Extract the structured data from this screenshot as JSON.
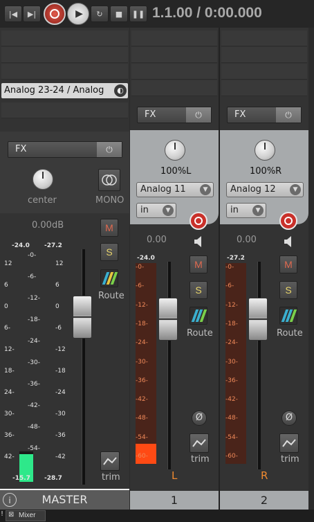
{
  "transport": {
    "timecode": "1.1.00 / 0:00.000",
    "buttons": [
      "skip-back-icon",
      "skip-forward-icon",
      "record-icon",
      "play-icon",
      "repeat-icon",
      "stop-icon",
      "pause-icon"
    ]
  },
  "master": {
    "input_label": "Analog 23-24 / Analog",
    "fx_label": "FX",
    "pan_label": "center",
    "mono_label": "MONO",
    "volume": "0.00dB",
    "peak_left": "-24.0",
    "peak_right": "-27.2",
    "mute_label": "M",
    "solo_label": "S",
    "route_label": "Route",
    "trim_label": "trim",
    "scale_left": [
      "12",
      "6",
      "0",
      "6-",
      "12-",
      "18-",
      "24-",
      "30-",
      "36-",
      "42-"
    ],
    "scale_mid": [
      "-0-",
      "-6-",
      "-12-",
      "-18-",
      "-24-",
      "-30-",
      "-36-",
      "-42-",
      "-48-",
      "-54-"
    ],
    "scale_right": [
      "12",
      "6",
      "0",
      "-6",
      "-12",
      "-18",
      "-24",
      "-30",
      "-36",
      "-42"
    ],
    "meter_bottom_left": "-15.7",
    "meter_bottom_right": "-28.7",
    "name": "MASTER",
    "info_icon": "i"
  },
  "tracks": [
    {
      "fx_label": "FX",
      "pan_label": "100%L",
      "input": "Analog 11",
      "in_label": "in",
      "volume": "0.00",
      "peak": "-24.0",
      "mute_label": "M",
      "solo_label": "S",
      "route_label": "Route",
      "trim_label": "trim",
      "phase_label": "Ø",
      "scale": [
        "-0-",
        "-6-",
        "-12-",
        "-18-",
        "-24-",
        "-30-",
        "-36-",
        "-42-",
        "-48-",
        "-54-",
        "-60-"
      ],
      "channel_label": "L",
      "number": "1",
      "meter_level": 0.1
    },
    {
      "fx_label": "FX",
      "pan_label": "100%R",
      "input": "Analog 12",
      "in_label": "in",
      "volume": "0.00",
      "peak": "-27.2",
      "mute_label": "M",
      "solo_label": "S",
      "route_label": "Route",
      "trim_label": "trim",
      "phase_label": "Ø",
      "scale": [
        "-0-",
        "-6-",
        "-12-",
        "-18-",
        "-24-",
        "-30-",
        "-36-",
        "-42-",
        "-48-",
        "-54-",
        "-60-"
      ],
      "channel_label": "R",
      "number": "2",
      "meter_level": 0.0
    }
  ],
  "tab": {
    "close_label": "⊠",
    "label": "Mixer",
    "mark": "!"
  },
  "colors": {
    "accent_record": "#c9302a",
    "meter_fill": "#ff4a14",
    "master_meter": "#2ee88a"
  }
}
